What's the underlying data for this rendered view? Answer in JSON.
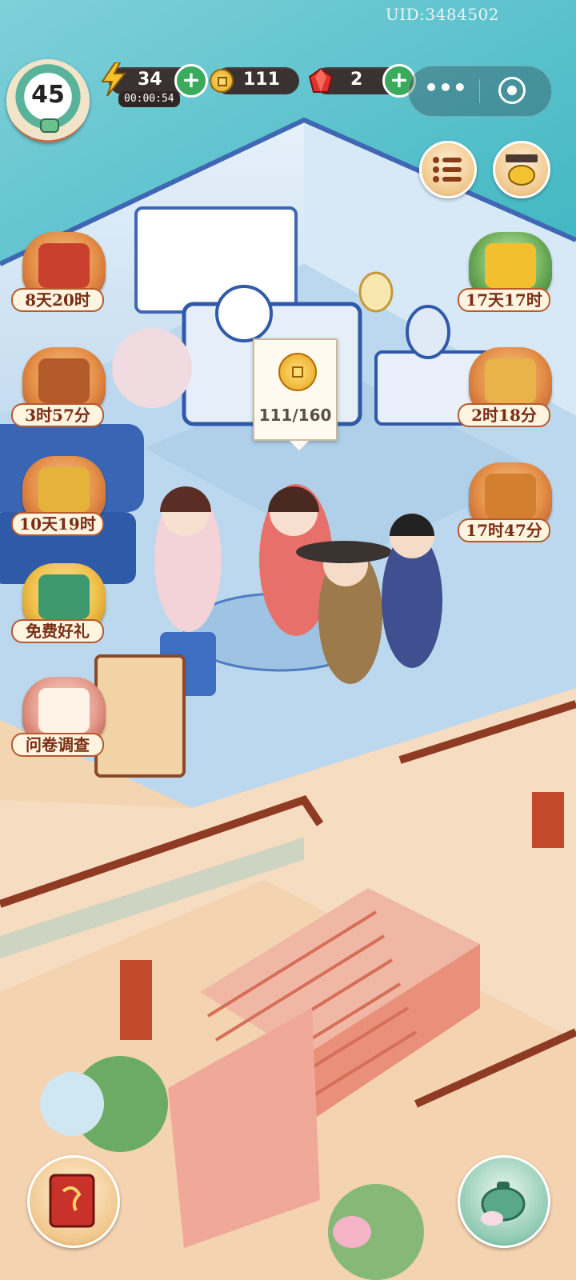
{
  "hud": {
    "uid": "UID:3484502",
    "level": "45",
    "energy": {
      "value": "34",
      "timer": "00:00:54",
      "plus": "+"
    },
    "coins": {
      "value": "111"
    },
    "gems": {
      "value": "2",
      "plus": "+"
    },
    "capsule": {
      "dots": "•••"
    }
  },
  "events_left": [
    {
      "label": "8天20时",
      "icon": "scroll-gift-icon"
    },
    {
      "label": "3时57分",
      "icon": "treasure-chest-icon"
    },
    {
      "label": "10天19时",
      "icon": "wheat-harvest-icon"
    },
    {
      "label": "免费好礼",
      "icon": "free-gift-icon"
    },
    {
      "label": "问卷调查",
      "icon": "survey-icon"
    }
  ],
  "events_right": [
    {
      "label": "17天17时",
      "icon": "chrysanthemum-icon"
    },
    {
      "label": "2时18分",
      "icon": "mooncake-icon"
    },
    {
      "label": "17时47分",
      "icon": "fruit-basket-icon"
    }
  ],
  "bubble": {
    "text": "111/160"
  },
  "colors": {
    "wall": "#cfe4f4",
    "floor": "#bcd8ee",
    "accent_orange": "#b6592d",
    "green_plus": "#3aab5d"
  }
}
